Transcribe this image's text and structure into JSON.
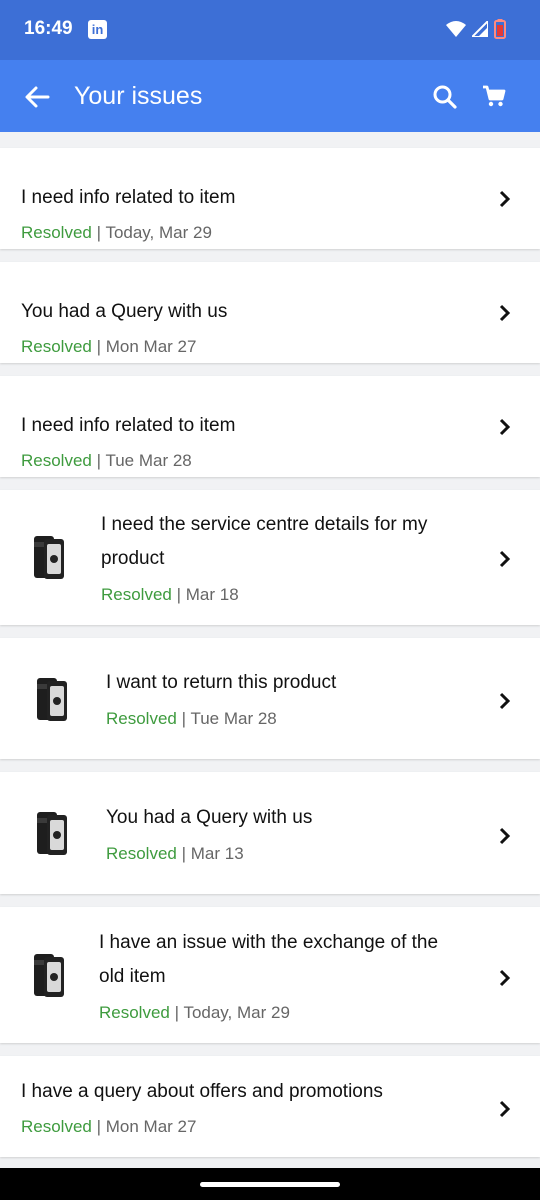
{
  "status": {
    "time": "16:49",
    "app_icon": "linkedin-icon"
  },
  "app_bar": {
    "title": "Your issues",
    "back_icon": "arrow-back-icon",
    "search_icon": "search-icon",
    "cart_icon": "cart-icon"
  },
  "status_color": "#3e9b3e",
  "issues": [
    {
      "title": "I need info related to item",
      "status": "Resolved",
      "date": "| Today, Mar 29",
      "has_image": false
    },
    {
      "title": "You had a Query with us",
      "status": "Resolved",
      "date": "| Mon Mar 27",
      "has_image": false
    },
    {
      "title": "I need info related to item",
      "status": "Resolved",
      "date": "| Tue Mar 28",
      "has_image": false
    },
    {
      "title_line1": "I need the service centre details for my",
      "title_line2": "product",
      "status": "Resolved",
      "date": "| Mar 18",
      "has_image": true
    },
    {
      "title": "I want to return this product",
      "status": "Resolved",
      "date": "| Tue Mar 28",
      "has_image": true
    },
    {
      "title": "You had a Query with us",
      "status": "Resolved",
      "date": "| Mar 13",
      "has_image": true
    },
    {
      "title_line1": "I have an issue with the exchange of the",
      "title_line2": "old item",
      "status": "Resolved",
      "date": "| Today, Mar 29",
      "has_image": true
    },
    {
      "title": "I have a query about offers and promotions",
      "status": "Resolved",
      "date": "| Mon Mar 27",
      "has_image": false
    }
  ]
}
